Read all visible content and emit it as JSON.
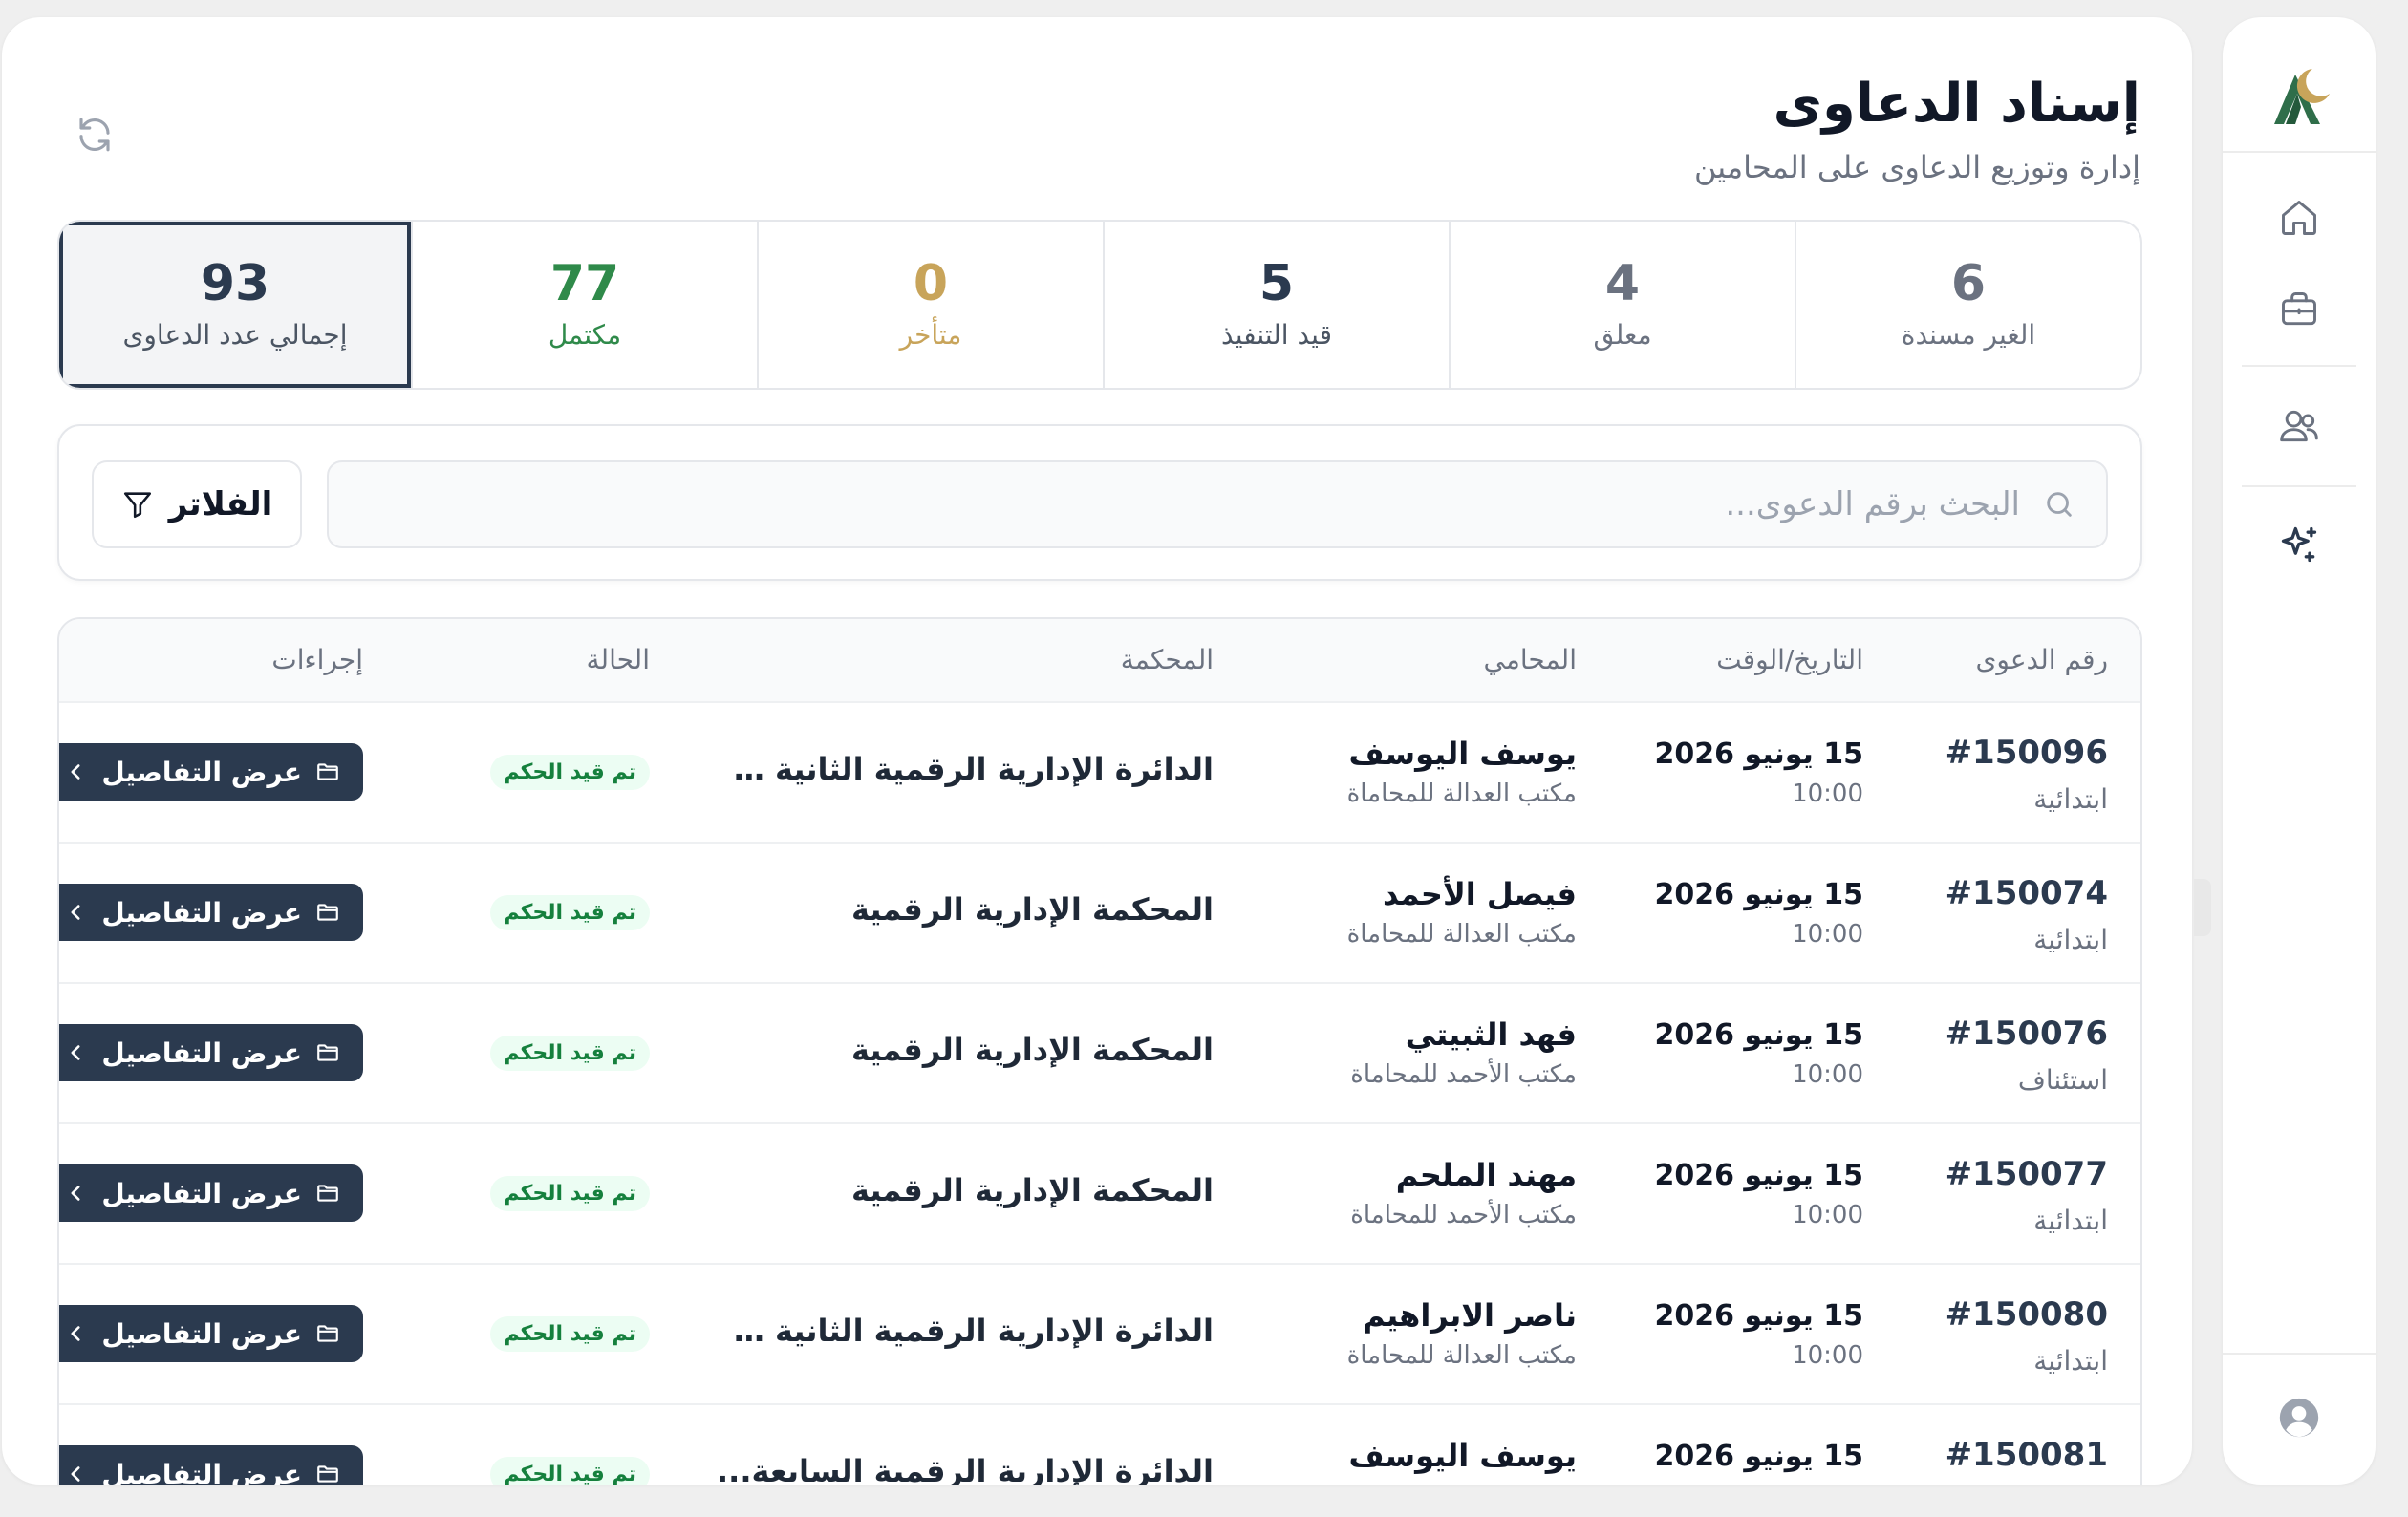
{
  "header": {
    "title": "إسناد الدعاوى",
    "subtitle": "إدارة وتوزيع الدعاوى على المحامين"
  },
  "stats": [
    {
      "value": "6",
      "label": "الغير مسندة",
      "color": "#6b7280"
    },
    {
      "value": "4",
      "label": "معلق",
      "color": "#6b7280"
    },
    {
      "value": "5",
      "label": "قيد التنفيذ",
      "color": "#2b3a4f"
    },
    {
      "value": "0",
      "label": "متأخر",
      "color": "#c8a45a"
    },
    {
      "value": "77",
      "label": "مكتمل",
      "color": "#2f8a4a"
    },
    {
      "value": "93",
      "label": "إجمالي عدد الدعاوى",
      "color": "#2b3a4f"
    }
  ],
  "search": {
    "placeholder": "البحث برقم الدعوى...",
    "filters_label": "الفلاتر"
  },
  "table": {
    "columns": {
      "case_no": "رقم الدعوى",
      "datetime": "التاريخ/الوقت",
      "lawyer": "المحامي",
      "court": "المحكمة",
      "status": "الحالة",
      "actions": "إجراءات"
    },
    "action_label": "عرض التفاصيل",
    "rows": [
      {
        "no": "#150096",
        "type": "ابتدائية",
        "date": "15 يونيو 2026",
        "time": "10:00",
        "lawyer": "يوسف اليوسف",
        "office": "مكتب العدالة للمحاماة",
        "court": "الدائرة الإدارية الرقمية الثانية عـ...",
        "status": "تم قيد الحكم"
      },
      {
        "no": "#150074",
        "type": "ابتدائية",
        "date": "15 يونيو 2026",
        "time": "10:00",
        "lawyer": "فيصل الأحمد",
        "office": "مكتب العدالة للمحاماة",
        "court": "المحكمة الإدارية الرقمية",
        "status": "تم قيد الحكم"
      },
      {
        "no": "#150076",
        "type": "استئناف",
        "date": "15 يونيو 2026",
        "time": "10:00",
        "lawyer": "فهد الثبيتي",
        "office": "مكتب الأحمد للمحاماة",
        "court": "المحكمة الإدارية الرقمية",
        "status": "تم قيد الحكم"
      },
      {
        "no": "#150077",
        "type": "ابتدائية",
        "date": "15 يونيو 2026",
        "time": "10:00",
        "lawyer": "مهند الملحم",
        "office": "مكتب الأحمد للمحاماة",
        "court": "المحكمة الإدارية الرقمية",
        "status": "تم قيد الحكم"
      },
      {
        "no": "#150080",
        "type": "ابتدائية",
        "date": "15 يونيو 2026",
        "time": "10:00",
        "lawyer": "ناصر الابراهيم",
        "office": "مكتب العدالة للمحاماة",
        "court": "الدائرة الإدارية الرقمية الثانية عـ...",
        "status": "تم قيد الحكم"
      },
      {
        "no": "#150081",
        "type": "",
        "date": "15 يونيو 2026",
        "time": "",
        "lawyer": "يوسف اليوسف",
        "office": "",
        "court": "الدائرة الإدارية الرقمية السابعة...",
        "status": "تم قيد الحكم"
      }
    ]
  },
  "rail": {
    "icons": [
      "home-icon",
      "briefcase-icon",
      "users-icon",
      "sparkles-icon",
      "user-avatar-icon"
    ]
  }
}
